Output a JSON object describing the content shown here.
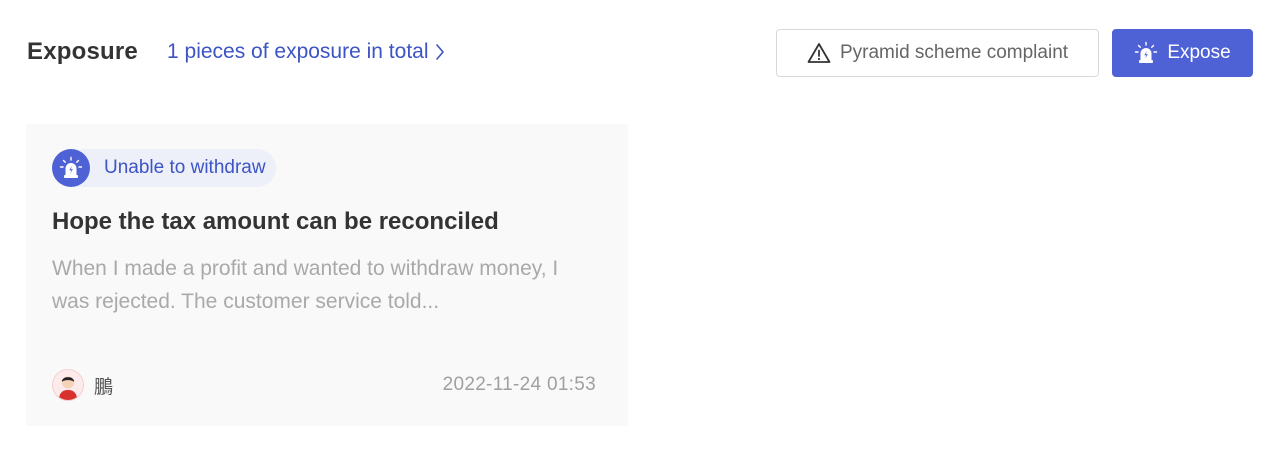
{
  "header": {
    "title": "Exposure",
    "count_link": "1 pieces of exposure in total"
  },
  "actions": {
    "complaint_label": "Pyramid scheme complaint",
    "expose_label": "Expose"
  },
  "cards": [
    {
      "tag": "Unable to withdraw",
      "title": "Hope the tax amount can be reconciled",
      "description": "When I made a profit and wanted to withdraw money, I was rejected. The customer service told...",
      "author": "鵬",
      "date": "2022-11-24 01:53"
    }
  ],
  "icons": {
    "chevron": "chevron-right-icon",
    "warning": "warning-icon",
    "alarm": "alarm-light-icon",
    "avatar": "user-avatar"
  },
  "colors": {
    "accent": "#4e62d6",
    "link": "#3c54c4",
    "card_bg": "#f9f9f9",
    "muted_text": "#a9a9a9"
  }
}
